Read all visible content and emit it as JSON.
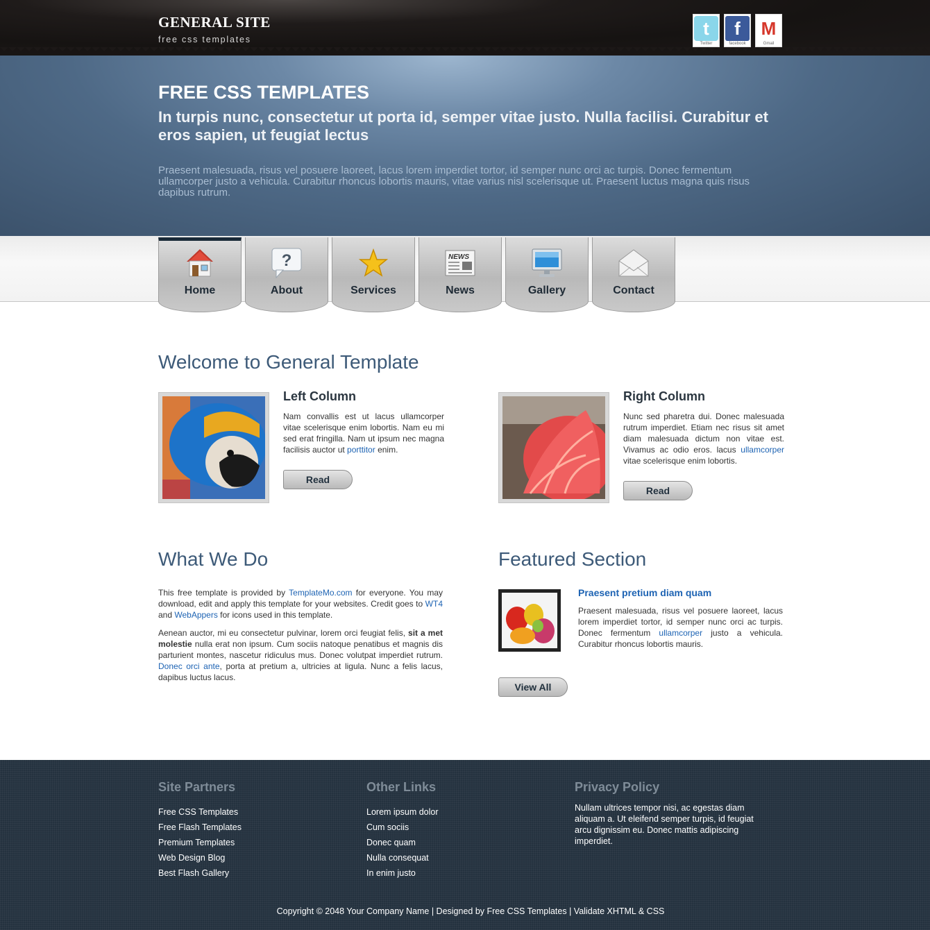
{
  "header": {
    "site_title": "GENERAL SITE",
    "tagline": "free css templates",
    "social": [
      {
        "name": "twitter",
        "caption": "Twitter",
        "icon": "twitter-icon"
      },
      {
        "name": "facebook",
        "caption": "facebook",
        "icon": "facebook-icon"
      },
      {
        "name": "gmail",
        "caption": "Gmail",
        "icon": "gmail-icon"
      }
    ]
  },
  "banner": {
    "title": "FREE CSS TEMPLATES",
    "subtitle": "In turpis nunc, consectetur ut porta id, semper vitae justo. Nulla facilisi. Curabitur et eros sapien, ut feugiat lectus",
    "text": "Praesent malesuada, risus vel posuere laoreet, lacus lorem imperdiet tortor, id semper nunc orci ac turpis. Donec fermentum ullamcorper justo a vehicula. Curabitur rhoncus lobortis mauris, vitae varius nisl scelerisque ut. Praesent luctus magna quis risus dapibus rutrum."
  },
  "nav": {
    "items": [
      {
        "label": "Home",
        "icon": "home-icon",
        "active": true
      },
      {
        "label": "About",
        "icon": "question-bubble-icon"
      },
      {
        "label": "Services",
        "icon": "star-icon"
      },
      {
        "label": "News",
        "icon": "newspaper-icon"
      },
      {
        "label": "Gallery",
        "icon": "monitor-icon"
      },
      {
        "label": "Contact",
        "icon": "envelope-icon"
      }
    ]
  },
  "welcome": {
    "heading": "Welcome to General Template",
    "left": {
      "title": "Left Column",
      "text_before": "Nam convallis est ut lacus ullamcorper vitae scelerisque enim lobortis. Nam eu mi sed erat fringilla. Nam ut ipsum nec magna facilisis auctor ut ",
      "link": "porttitor",
      "text_after": " enim.",
      "button": "Read"
    },
    "right": {
      "title": "Right Column",
      "text_before": "Nunc sed pharetra dui. Donec malesuada rutrum imperdiet. Etiam nec risus sit amet diam malesuada dictum non vitae est. Vivamus ac odio eros. lacus ",
      "link": "ullamcorper",
      "text_after": " vitae scelerisque enim lobortis.",
      "button": "Read"
    }
  },
  "what_we_do": {
    "heading": "What We Do",
    "p1_a": "This free template is provided by ",
    "p1_link1": "TemplateMo.com",
    "p1_b": " for everyone. You may download, edit and apply this template for your websites. Credit goes to ",
    "p1_link2": "WT4",
    "p1_c": " and ",
    "p1_link3": "WebAppers",
    "p1_d": " for icons used in this template.",
    "p2_a": "Aenean auctor, mi eu consectetur pulvinar, lorem orci feugiat felis, ",
    "p2_bold": "sit a met molestie",
    "p2_b": " nulla erat non ipsum. Cum sociis natoque penatibus et magnis dis parturient montes, nascetur ridiculus mus. Donec volutpat imperdiet rutrum. ",
    "p2_link": "Donec orci ante",
    "p2_c": ", porta at pretium a, ultricies at ligula. Nunc a felis lacus, dapibus luctus lacus."
  },
  "featured": {
    "heading": "Featured Section",
    "title": "Praesent pretium diam quam",
    "text_before": "Praesent malesuada, risus vel posuere laoreet, lacus lorem imperdiet tortor, id semper nunc orci ac turpis. Donec fermentum ",
    "link": "ullamcorper",
    "text_after": " justo a vehicula. Curabitur rhoncus lobortis mauris.",
    "button": "View All"
  },
  "footer": {
    "partners": {
      "heading": "Site Partners",
      "links": [
        "Free CSS Templates",
        "Free Flash Templates",
        "Premium Templates",
        "Web Design Blog",
        "Best Flash Gallery"
      ]
    },
    "other": {
      "heading": "Other Links",
      "links": [
        "Lorem ipsum dolor",
        "Cum sociis",
        "Donec quam",
        "Nulla consequat",
        "In enim justo"
      ]
    },
    "privacy": {
      "heading": "Privacy Policy",
      "text": "Nullam ultrices tempor nisi, ac egestas diam aliquam a. Ut eleifend semper turpis, id feugiat arcu dignissim eu. Donec mattis adipiscing imperdiet."
    },
    "copyright": "Copyright © 2048 Your Company Name | Designed by Free CSS Templates | Validate XHTML & CSS"
  }
}
